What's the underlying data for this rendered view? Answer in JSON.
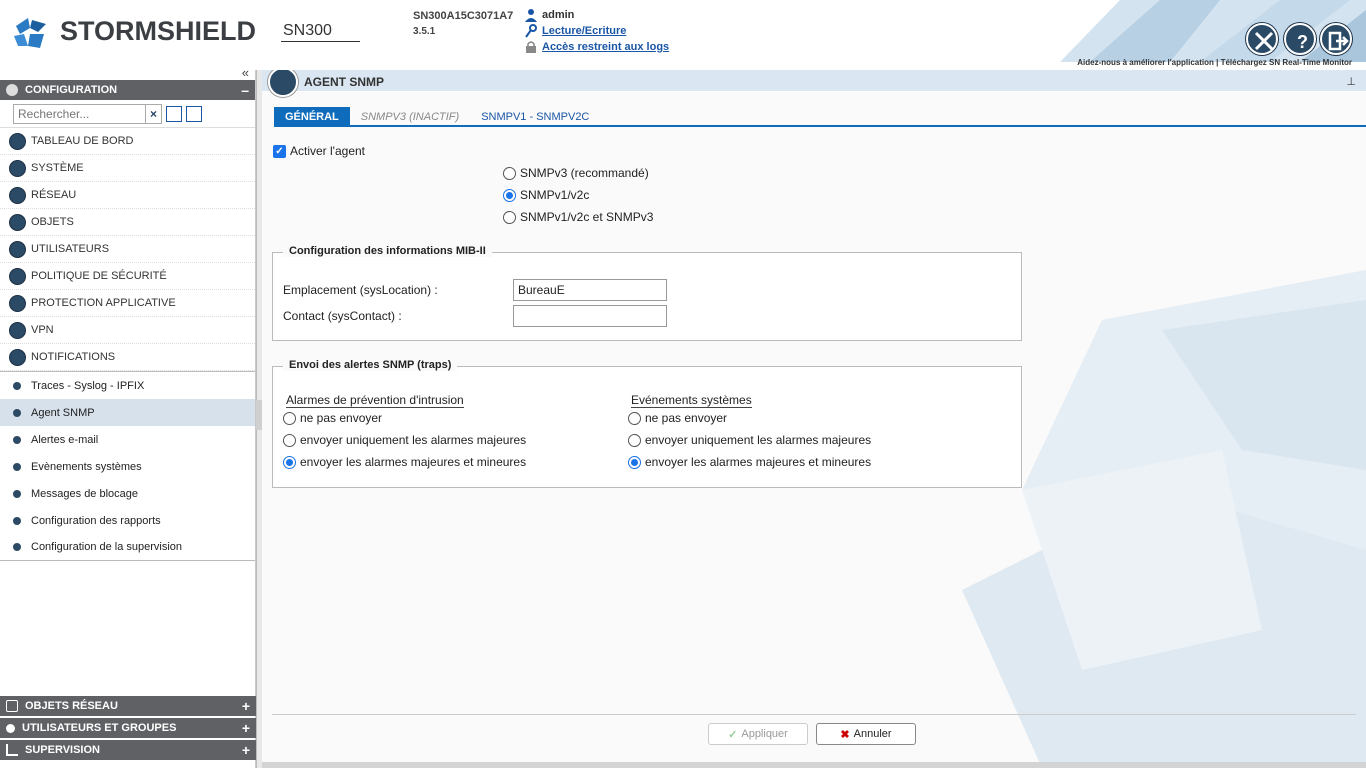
{
  "header": {
    "brand": "STORMSHIELD",
    "model": "SN300",
    "serial": "SN300A15C3071A7",
    "version": "3.5.1",
    "user": "admin",
    "access_mode": "Lecture/Ecriture",
    "restricted_logs": "Accès restreint aux logs",
    "help_links": "Aidez-nous à améliorer l'application  |  Téléchargez SN Real-Time Monitor",
    "accent_color": "#2b4a66"
  },
  "sidebar": {
    "section": "CONFIGURATION",
    "search": {
      "placeholder": "Rechercher..."
    },
    "menu": [
      {
        "label": "TABLEAU DE BORD",
        "icon": "dashboard-icon"
      },
      {
        "label": "SYSTÈME",
        "icon": "system-icon"
      },
      {
        "label": "RÉSEAU",
        "icon": "network-icon"
      },
      {
        "label": "OBJETS",
        "icon": "objects-icon"
      },
      {
        "label": "UTILISATEURS",
        "icon": "users-icon"
      },
      {
        "label": "POLITIQUE DE SÉCURITÉ",
        "icon": "security-policy-icon"
      },
      {
        "label": "PROTECTION APPLICATIVE",
        "icon": "shield-icon"
      },
      {
        "label": "VPN",
        "icon": "vpn-icon"
      },
      {
        "label": "NOTIFICATIONS",
        "icon": "notifications-icon"
      }
    ],
    "submenu": [
      {
        "label": "Traces - Syslog - IPFIX"
      },
      {
        "label": "Agent SNMP"
      },
      {
        "label": "Alertes e-mail"
      },
      {
        "label": "Evènements systèmes"
      },
      {
        "label": "Messages de blocage"
      },
      {
        "label": "Configuration des rapports"
      },
      {
        "label": "Configuration de la supervision"
      }
    ],
    "bottom_sections": [
      {
        "label": "OBJETS RÉSEAU"
      },
      {
        "label": "UTILISATEURS ET GROUPES"
      },
      {
        "label": "SUPERVISION"
      }
    ]
  },
  "page": {
    "title": "AGENT SNMP",
    "tabs": [
      "GÉNÉRAL",
      "SNMPV3 (INACTIF)",
      "SNMPV1 - SNMPV2C"
    ],
    "enable_agent": "Activer l'agent",
    "versions": [
      "SNMPv3 (recommandé)",
      "SNMPv1/v2c",
      "SNMPv1/v2c et SNMPv3"
    ],
    "mib": {
      "legend": "Configuration des informations MIB-II",
      "location_label": "Emplacement (sysLocation) :",
      "location_value": "BureauE",
      "contact_label": "Contact (sysContact) :",
      "contact_value": ""
    },
    "traps": {
      "legend": "Envoi des alertes SNMP (traps)",
      "ips_title": "Alarmes de prévention d'intrusion",
      "sys_title": "Evénements systèmes",
      "options": [
        "ne pas envoyer",
        "envoyer uniquement les alarmes majeures",
        "envoyer les alarmes majeures et mineures"
      ]
    },
    "apply": "Appliquer",
    "cancel": "Annuler"
  }
}
